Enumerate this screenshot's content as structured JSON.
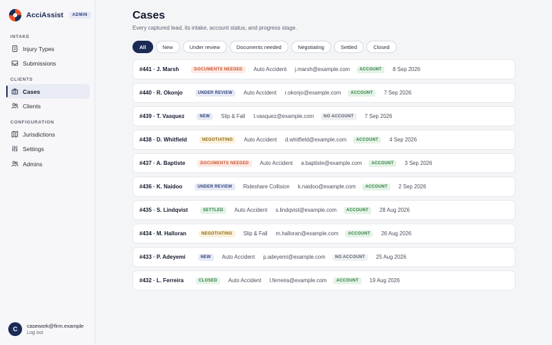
{
  "brand": {
    "name": "AcciAssist",
    "badge": "ADMIN"
  },
  "nav": {
    "sections": [
      {
        "title": "INTAKE",
        "items": [
          {
            "label": "Injury Types",
            "icon": "tag-icon"
          },
          {
            "label": "Submissions",
            "icon": "inbox-icon"
          }
        ]
      },
      {
        "title": "CLIENTS",
        "items": [
          {
            "label": "Cases",
            "icon": "briefcase-icon",
            "active": true
          },
          {
            "label": "Clients",
            "icon": "users-icon"
          }
        ]
      },
      {
        "title": "CONFIGURATION",
        "items": [
          {
            "label": "Jurisdictions",
            "icon": "map-icon"
          },
          {
            "label": "Settings",
            "icon": "sliders-icon"
          },
          {
            "label": "Admins",
            "icon": "admins-icon"
          }
        ]
      }
    ]
  },
  "user": {
    "initial": "C",
    "email": "casework@firm.example",
    "logout": "Log out"
  },
  "page": {
    "title": "Cases",
    "subtitle": "Every captured lead, its intake, account status, and progress stage."
  },
  "filters": [
    {
      "label": "All",
      "active": true
    },
    {
      "label": "New"
    },
    {
      "label": "Under review"
    },
    {
      "label": "Documents needed"
    },
    {
      "label": "Negotiating"
    },
    {
      "label": "Settled"
    },
    {
      "label": "Closed"
    }
  ],
  "cases": [
    {
      "id": "#441 · J. Marsh",
      "status": "DOCUMENTS NEEDED",
      "type": "Auto Accident",
      "email": "j.marsh@example.com",
      "account": "ACCOUNT",
      "date": "8 Sep 2026"
    },
    {
      "id": "#440 · R. Okonjo",
      "status": "UNDER REVIEW",
      "type": "Auto Accident",
      "email": "r.okonjo@example.com",
      "account": "ACCOUNT",
      "date": "7 Sep 2026"
    },
    {
      "id": "#439 · T. Vasquez",
      "status": "NEW",
      "type": "Slip & Fall",
      "email": "t.vasquez@example.com",
      "account": "NO ACCOUNT",
      "date": "7 Sep 2026"
    },
    {
      "id": "#438 · D. Whitfield",
      "status": "NEGOTIATING",
      "type": "Auto Accident",
      "email": "d.whitfield@example.com",
      "account": "ACCOUNT",
      "date": "4 Sep 2026"
    },
    {
      "id": "#437 · A. Baptiste",
      "status": "DOCUMENTS NEEDED",
      "type": "Auto Accident",
      "email": "a.baptiste@example.com",
      "account": "ACCOUNT",
      "date": "3 Sep 2026"
    },
    {
      "id": "#436 · K. Naidoo",
      "status": "UNDER REVIEW",
      "type": "Rideshare Collision",
      "email": "k.naidoo@example.com",
      "account": "ACCOUNT",
      "date": "2 Sep 2026"
    },
    {
      "id": "#435 · S. Lindqvist",
      "status": "SETTLED",
      "type": "Auto Accident",
      "email": "s.lindqvist@example.com",
      "account": "ACCOUNT",
      "date": "28 Aug 2026"
    },
    {
      "id": "#434 · M. Halloran",
      "status": "NEGOTIATING",
      "type": "Slip & Fall",
      "email": "m.halloran@example.com",
      "account": "ACCOUNT",
      "date": "26 Aug 2026"
    },
    {
      "id": "#433 · P. Adeyemi",
      "status": "NEW",
      "type": "Auto Accident",
      "email": "p.adeyemi@example.com",
      "account": "NO ACCOUNT",
      "date": "25 Aug 2026"
    },
    {
      "id": "#432 · L. Ferreira",
      "status": "CLOSED",
      "type": "Auto Accident",
      "email": "l.ferreira@example.com",
      "account": "ACCOUNT",
      "date": "19 Aug 2026"
    }
  ]
}
